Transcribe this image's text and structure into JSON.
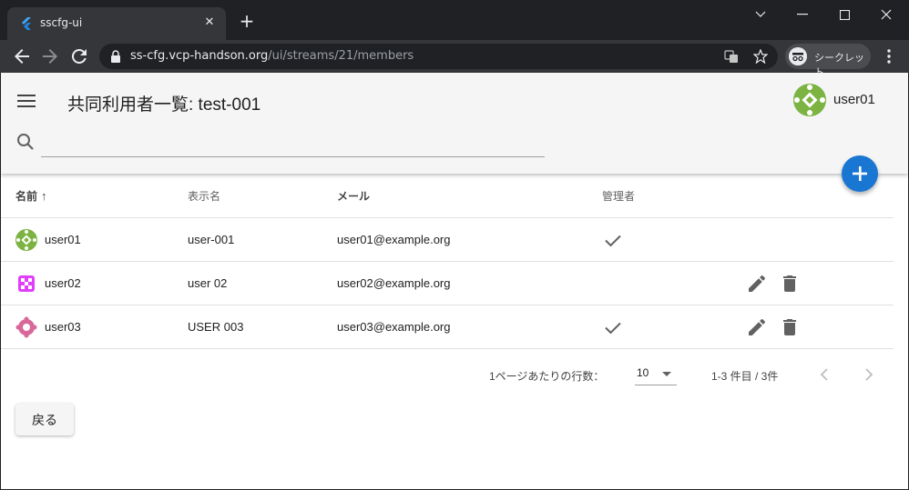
{
  "browser": {
    "tab_title": "sscfg-ui",
    "tab_close": "✕",
    "new_tab": "+",
    "url_host": "ss-cfg.vcp-handson.org",
    "url_path": "/ui/streams/21/members",
    "incognito_label": "シークレット",
    "window_controls": [
      "﹀",
      "—",
      "☐",
      "✕"
    ]
  },
  "app": {
    "page_title": "共同利用者一覧: test-001",
    "user_name": "user01",
    "search_placeholder": ""
  },
  "table": {
    "headers": {
      "name": "名前",
      "sort_indicator": "↑",
      "display_name": "表示名",
      "email": "メール",
      "admin": "管理者"
    },
    "rows": [
      {
        "name": "user01",
        "display_name": "user-001",
        "email": "user01@example.org",
        "admin": true,
        "actions": false,
        "avatar_color": "#7cb342"
      },
      {
        "name": "user02",
        "display_name": "user 02",
        "email": "user02@example.org",
        "admin": false,
        "actions": true,
        "avatar_color": "#e040fb"
      },
      {
        "name": "user03",
        "display_name": "USER 003",
        "email": "user03@example.org",
        "admin": true,
        "actions": true,
        "avatar_color": "#d8689a"
      }
    ]
  },
  "pagination": {
    "rows_per_page_label": "1ページあたりの行数：",
    "rows_per_page_value": "10",
    "range_text": "1-3 件目 / 3件"
  },
  "actions": {
    "back_label": "戻る"
  },
  "colors": {
    "accent": "#1976d2",
    "appbar_bg": "#f5f5f5",
    "icon_grey": "#616161"
  }
}
